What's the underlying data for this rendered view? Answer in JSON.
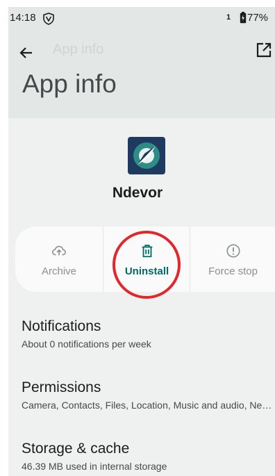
{
  "status_bar": {
    "time": "14:18",
    "sim_label": "1",
    "battery": "77%",
    "icons": [
      "vpn-shield-icon",
      "battery-icon"
    ]
  },
  "toolbar": {
    "faded_title": "App info",
    "icons": [
      "back-arrow-icon",
      "open-in-new-icon"
    ]
  },
  "page": {
    "title": "App info"
  },
  "app": {
    "name": "Ndevor",
    "icon": "ndevor-app-icon"
  },
  "actions": [
    {
      "label": "Archive",
      "icon": "cloud-upload-icon",
      "enabled": false
    },
    {
      "label": "Uninstall",
      "icon": "trash-icon",
      "enabled": true
    },
    {
      "label": "Force stop",
      "icon": "alert-circle-icon",
      "enabled": false
    }
  ],
  "preferences": [
    {
      "title": "Notifications",
      "summary": "About 0 notifications per week"
    },
    {
      "title": "Permissions",
      "summary": "Camera, Contacts, Files, Location, Music and audio, Nearby devices, Notifications, Phone"
    },
    {
      "title": "Storage & cache",
      "summary": "46.39 MB used in internal storage"
    }
  ],
  "colors": {
    "accent": "#006a67",
    "highlight_ring": "#e1272b",
    "header_bg": "#e3e7e6",
    "screen_bg": "#eff1f0",
    "disabled": "#8a908f"
  }
}
